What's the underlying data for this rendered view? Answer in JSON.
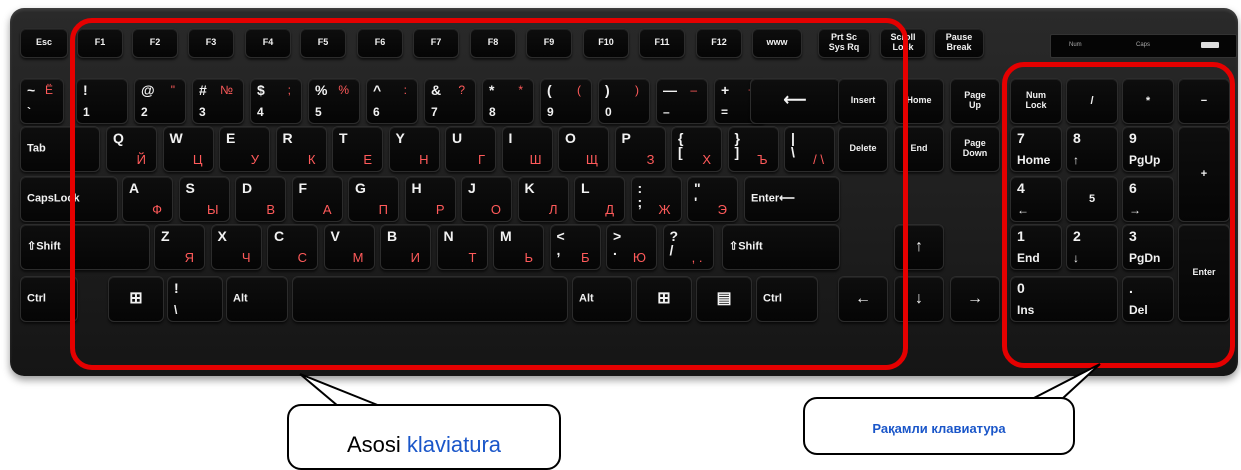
{
  "keyboard": {
    "indicator_panel": {
      "num": "Num",
      "caps": "Caps"
    },
    "function_row": [
      "Esc",
      "F1",
      "F2",
      "F3",
      "F4",
      "F5",
      "F6",
      "F7",
      "F8",
      "F9",
      "F10",
      "F11",
      "F12",
      "www",
      "Prt Sc\nSys Rq",
      "Scroll\nLock",
      "Pause\nBreak"
    ],
    "number_row": [
      {
        "top": "~",
        "bottom": "`",
        "cyr_top": "Ё",
        "cyr_bottom": ""
      },
      {
        "top": "!",
        "bottom": "1",
        "cyr_top": "",
        "cyr_bottom": ""
      },
      {
        "top": "@",
        "bottom": "2",
        "cyr_top": "\"",
        "cyr_bottom": ""
      },
      {
        "top": "#",
        "bottom": "3",
        "cyr_top": "№",
        "cyr_bottom": ""
      },
      {
        "top": "$",
        "bottom": "4",
        "cyr_top": ";",
        "cyr_bottom": ""
      },
      {
        "top": "%",
        "bottom": "5",
        "cyr_top": "%",
        "cyr_bottom": ""
      },
      {
        "top": "^",
        "bottom": "6",
        "cyr_top": ":",
        "cyr_bottom": ""
      },
      {
        "top": "&",
        "bottom": "7",
        "cyr_top": "?",
        "cyr_bottom": ""
      },
      {
        "top": "*",
        "bottom": "8",
        "cyr_top": "*",
        "cyr_bottom": ""
      },
      {
        "top": "(",
        "bottom": "9",
        "cyr_top": "(",
        "cyr_bottom": ""
      },
      {
        "top": ")",
        "bottom": "0",
        "cyr_top": ")",
        "cyr_bottom": ""
      },
      {
        "top": "—",
        "bottom": "–",
        "cyr_top": "–",
        "cyr_bottom": ""
      },
      {
        "top": "+",
        "bottom": "=",
        "cyr_top": "+",
        "cyr_bottom": ""
      }
    ],
    "backspace": "⟵",
    "tab": "Tab",
    "caps_lock": "CapsLock",
    "shift_left": "⇧Shift",
    "shift_right": "⇧Shift",
    "enter": "Enter⟵",
    "ctrl_left": "Ctrl",
    "ctrl_right": "Ctrl",
    "alt_left": "Alt",
    "alt_right": "Alt",
    "win_key": "⊞",
    "menu_key": "▤",
    "backslash_key": {
      "top": "!",
      "bottom": "\\"
    },
    "qwerty_row": [
      {
        "lat": "Q",
        "cyr": "Й"
      },
      {
        "lat": "W",
        "cyr": "Ц"
      },
      {
        "lat": "E",
        "cyr": "У"
      },
      {
        "lat": "R",
        "cyr": "К"
      },
      {
        "lat": "T",
        "cyr": "Е"
      },
      {
        "lat": "Y",
        "cyr": "Н"
      },
      {
        "lat": "U",
        "cyr": "Г"
      },
      {
        "lat": "I",
        "cyr": "Ш"
      },
      {
        "lat": "O",
        "cyr": "Щ"
      },
      {
        "lat": "P",
        "cyr": "З"
      },
      {
        "lat": "{\n[",
        "cyr": "Х"
      },
      {
        "lat": "}\n]",
        "cyr": "Ъ"
      },
      {
        "lat": "|\n\\",
        "cyr": "/ \\"
      }
    ],
    "asdf_row": [
      {
        "lat": "A",
        "cyr": "Ф"
      },
      {
        "lat": "S",
        "cyr": "Ы"
      },
      {
        "lat": "D",
        "cyr": "В"
      },
      {
        "lat": "F",
        "cyr": "А"
      },
      {
        "lat": "G",
        "cyr": "П"
      },
      {
        "lat": "H",
        "cyr": "Р"
      },
      {
        "lat": "J",
        "cyr": "О"
      },
      {
        "lat": "K",
        "cyr": "Л"
      },
      {
        "lat": "L",
        "cyr": "Д"
      },
      {
        "lat": ":\n;",
        "cyr": "Ж"
      },
      {
        "lat": "\"\n'",
        "cyr": "Э"
      }
    ],
    "zxcv_row": [
      {
        "lat": "Z",
        "cyr": "Я"
      },
      {
        "lat": "X",
        "cyr": "Ч"
      },
      {
        "lat": "C",
        "cyr": "С"
      },
      {
        "lat": "V",
        "cyr": "М"
      },
      {
        "lat": "B",
        "cyr": "И"
      },
      {
        "lat": "N",
        "cyr": "Т"
      },
      {
        "lat": "M",
        "cyr": "Ь"
      },
      {
        "lat": "<\n,",
        "cyr": "Б"
      },
      {
        "lat": ">\n.",
        "cyr": "Ю"
      },
      {
        "lat": "?\n/",
        "cyr": ", ."
      }
    ],
    "nav_cluster": [
      "Insert",
      "Home",
      "Page\nUp",
      "Delete",
      "End",
      "Page\nDown"
    ],
    "arrows": {
      "up": "↑",
      "down": "↓",
      "left": "←",
      "right": "→"
    },
    "numpad": [
      {
        "top": "Num\nLock",
        "bottom": ""
      },
      {
        "top": "/",
        "bottom": ""
      },
      {
        "top": "*",
        "bottom": ""
      },
      {
        "top": "−",
        "bottom": ""
      },
      {
        "top": "7",
        "bottom": "Home"
      },
      {
        "top": "8",
        "bottom": "↑"
      },
      {
        "top": "9",
        "bottom": "PgUp"
      },
      {
        "top": "+",
        "bottom": ""
      },
      {
        "top": "4",
        "bottom": "←"
      },
      {
        "top": "5",
        "bottom": ""
      },
      {
        "top": "6",
        "bottom": "→"
      },
      {
        "top": "1",
        "bottom": "End"
      },
      {
        "top": "2",
        "bottom": "↓"
      },
      {
        "top": "3",
        "bottom": "PgDn"
      },
      {
        "top": "Enter",
        "bottom": ""
      },
      {
        "top": "0",
        "bottom": "Ins"
      },
      {
        "top": ".",
        "bottom": "Del"
      }
    ]
  },
  "callouts": {
    "main": {
      "prefix": "Asosi ",
      "highlight": "klaviatura"
    },
    "numpad": {
      "text": "Рақамли клавиатура"
    }
  },
  "colors": {
    "highlight_outline": "#e50000",
    "callout_blue": "#1a56c9",
    "cyrillic_red": "#ff5a5a"
  }
}
